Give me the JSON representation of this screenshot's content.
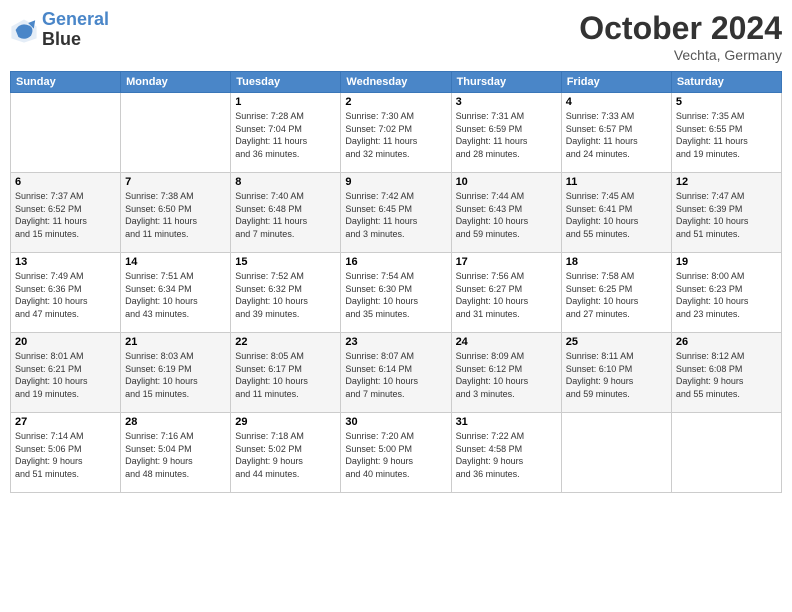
{
  "logo": {
    "line1": "General",
    "line2": "Blue"
  },
  "title": "October 2024",
  "subtitle": "Vechta, Germany",
  "weekdays": [
    "Sunday",
    "Monday",
    "Tuesday",
    "Wednesday",
    "Thursday",
    "Friday",
    "Saturday"
  ],
  "weeks": [
    [
      {
        "day": "",
        "info": ""
      },
      {
        "day": "",
        "info": ""
      },
      {
        "day": "1",
        "info": "Sunrise: 7:28 AM\nSunset: 7:04 PM\nDaylight: 11 hours\nand 36 minutes."
      },
      {
        "day": "2",
        "info": "Sunrise: 7:30 AM\nSunset: 7:02 PM\nDaylight: 11 hours\nand 32 minutes."
      },
      {
        "day": "3",
        "info": "Sunrise: 7:31 AM\nSunset: 6:59 PM\nDaylight: 11 hours\nand 28 minutes."
      },
      {
        "day": "4",
        "info": "Sunrise: 7:33 AM\nSunset: 6:57 PM\nDaylight: 11 hours\nand 24 minutes."
      },
      {
        "day": "5",
        "info": "Sunrise: 7:35 AM\nSunset: 6:55 PM\nDaylight: 11 hours\nand 19 minutes."
      }
    ],
    [
      {
        "day": "6",
        "info": "Sunrise: 7:37 AM\nSunset: 6:52 PM\nDaylight: 11 hours\nand 15 minutes."
      },
      {
        "day": "7",
        "info": "Sunrise: 7:38 AM\nSunset: 6:50 PM\nDaylight: 11 hours\nand 11 minutes."
      },
      {
        "day": "8",
        "info": "Sunrise: 7:40 AM\nSunset: 6:48 PM\nDaylight: 11 hours\nand 7 minutes."
      },
      {
        "day": "9",
        "info": "Sunrise: 7:42 AM\nSunset: 6:45 PM\nDaylight: 11 hours\nand 3 minutes."
      },
      {
        "day": "10",
        "info": "Sunrise: 7:44 AM\nSunset: 6:43 PM\nDaylight: 10 hours\nand 59 minutes."
      },
      {
        "day": "11",
        "info": "Sunrise: 7:45 AM\nSunset: 6:41 PM\nDaylight: 10 hours\nand 55 minutes."
      },
      {
        "day": "12",
        "info": "Sunrise: 7:47 AM\nSunset: 6:39 PM\nDaylight: 10 hours\nand 51 minutes."
      }
    ],
    [
      {
        "day": "13",
        "info": "Sunrise: 7:49 AM\nSunset: 6:36 PM\nDaylight: 10 hours\nand 47 minutes."
      },
      {
        "day": "14",
        "info": "Sunrise: 7:51 AM\nSunset: 6:34 PM\nDaylight: 10 hours\nand 43 minutes."
      },
      {
        "day": "15",
        "info": "Sunrise: 7:52 AM\nSunset: 6:32 PM\nDaylight: 10 hours\nand 39 minutes."
      },
      {
        "day": "16",
        "info": "Sunrise: 7:54 AM\nSunset: 6:30 PM\nDaylight: 10 hours\nand 35 minutes."
      },
      {
        "day": "17",
        "info": "Sunrise: 7:56 AM\nSunset: 6:27 PM\nDaylight: 10 hours\nand 31 minutes."
      },
      {
        "day": "18",
        "info": "Sunrise: 7:58 AM\nSunset: 6:25 PM\nDaylight: 10 hours\nand 27 minutes."
      },
      {
        "day": "19",
        "info": "Sunrise: 8:00 AM\nSunset: 6:23 PM\nDaylight: 10 hours\nand 23 minutes."
      }
    ],
    [
      {
        "day": "20",
        "info": "Sunrise: 8:01 AM\nSunset: 6:21 PM\nDaylight: 10 hours\nand 19 minutes."
      },
      {
        "day": "21",
        "info": "Sunrise: 8:03 AM\nSunset: 6:19 PM\nDaylight: 10 hours\nand 15 minutes."
      },
      {
        "day": "22",
        "info": "Sunrise: 8:05 AM\nSunset: 6:17 PM\nDaylight: 10 hours\nand 11 minutes."
      },
      {
        "day": "23",
        "info": "Sunrise: 8:07 AM\nSunset: 6:14 PM\nDaylight: 10 hours\nand 7 minutes."
      },
      {
        "day": "24",
        "info": "Sunrise: 8:09 AM\nSunset: 6:12 PM\nDaylight: 10 hours\nand 3 minutes."
      },
      {
        "day": "25",
        "info": "Sunrise: 8:11 AM\nSunset: 6:10 PM\nDaylight: 9 hours\nand 59 minutes."
      },
      {
        "day": "26",
        "info": "Sunrise: 8:12 AM\nSunset: 6:08 PM\nDaylight: 9 hours\nand 55 minutes."
      }
    ],
    [
      {
        "day": "27",
        "info": "Sunrise: 7:14 AM\nSunset: 5:06 PM\nDaylight: 9 hours\nand 51 minutes."
      },
      {
        "day": "28",
        "info": "Sunrise: 7:16 AM\nSunset: 5:04 PM\nDaylight: 9 hours\nand 48 minutes."
      },
      {
        "day": "29",
        "info": "Sunrise: 7:18 AM\nSunset: 5:02 PM\nDaylight: 9 hours\nand 44 minutes."
      },
      {
        "day": "30",
        "info": "Sunrise: 7:20 AM\nSunset: 5:00 PM\nDaylight: 9 hours\nand 40 minutes."
      },
      {
        "day": "31",
        "info": "Sunrise: 7:22 AM\nSunset: 4:58 PM\nDaylight: 9 hours\nand 36 minutes."
      },
      {
        "day": "",
        "info": ""
      },
      {
        "day": "",
        "info": ""
      }
    ]
  ]
}
